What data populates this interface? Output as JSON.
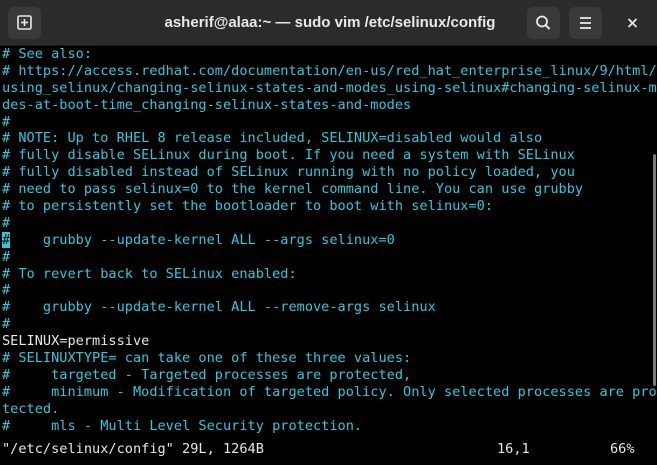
{
  "window": {
    "title": "asherif@alaa:~ — sudo vim /etc/selinux/config",
    "new_tab_icon": "new-tab-icon",
    "search_icon": "search-icon",
    "menu_icon": "hamburger-menu-icon",
    "close_icon": "close-icon"
  },
  "editor": {
    "lines": [
      {
        "text": "# See also:",
        "type": "comment"
      },
      {
        "text": "# https://access.redhat.com/documentation/en-us/red_hat_enterprise_linux/9/html/",
        "type": "comment"
      },
      {
        "text": "using_selinux/changing-selinux-states-and-modes_using-selinux#changing-selinux-mo",
        "type": "comment"
      },
      {
        "text": "des-at-boot-time_changing-selinux-states-and-modes",
        "type": "comment"
      },
      {
        "text": "#",
        "type": "comment"
      },
      {
        "text": "# NOTE: Up to RHEL 8 release included, SELINUX=disabled would also",
        "type": "comment"
      },
      {
        "text": "# fully disable SELinux during boot. If you need a system with SELinux",
        "type": "comment"
      },
      {
        "text": "# fully disabled instead of SELinux running with no policy loaded, you",
        "type": "comment"
      },
      {
        "text": "# need to pass selinux=0 to the kernel command line. You can use grubby",
        "type": "comment"
      },
      {
        "text": "# to persistently set the bootloader to boot with selinux=0:",
        "type": "comment"
      },
      {
        "text": "#",
        "type": "comment"
      },
      {
        "text": "#    grubby --update-kernel ALL --args selinux=0",
        "type": "comment",
        "cursor": true
      },
      {
        "text": "#",
        "type": "comment"
      },
      {
        "text": "# To revert back to SELinux enabled:",
        "type": "comment"
      },
      {
        "text": "#",
        "type": "comment"
      },
      {
        "text": "#    grubby --update-kernel ALL --remove-args selinux",
        "type": "comment"
      },
      {
        "text": "#",
        "type": "comment"
      },
      {
        "text": "SELINUX=permissive",
        "type": "normal"
      },
      {
        "text": "# SELINUXTYPE= can take one of these three values:",
        "type": "comment"
      },
      {
        "text": "#     targeted - Targeted processes are protected,",
        "type": "comment"
      },
      {
        "text": "#     minimum - Modification of targeted policy. Only selected processes are pro",
        "type": "comment"
      },
      {
        "text": "tected.",
        "type": "comment"
      },
      {
        "text": "#     mls - Multi Level Security protection.",
        "type": "comment"
      }
    ]
  },
  "status": {
    "file_info": "\"/etc/selinux/config\" 29L, 1264B",
    "cursor_position": "16,1",
    "scroll_percent": "66%"
  },
  "scrollbar": {
    "position_fraction": 0.66
  },
  "colors": {
    "comment": "#33c7de",
    "normal_text": "#e8e8e8",
    "background": "#000000",
    "titlebar": "#2b2b2b"
  }
}
